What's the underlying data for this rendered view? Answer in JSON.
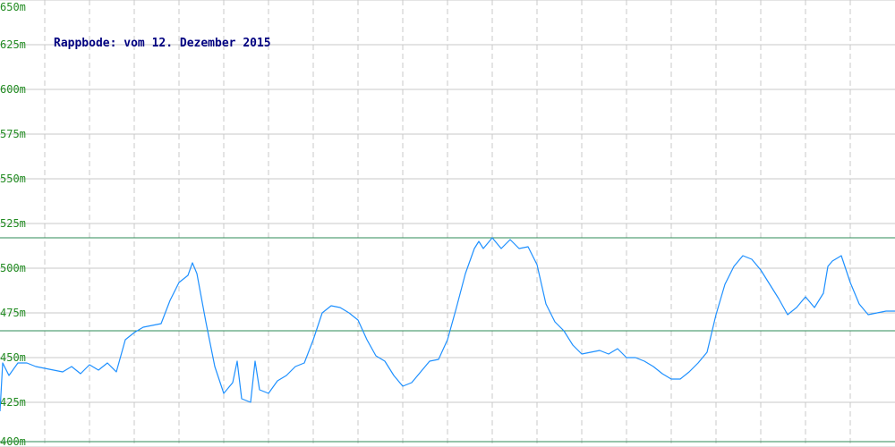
{
  "chart_data": {
    "type": "line",
    "title": "Rappbode: vom 12. Dezember 2015",
    "xlabel": "",
    "ylabel": "",
    "ylim": [
      400,
      650
    ],
    "yticks": [
      {
        "value": 650,
        "label": "650m"
      },
      {
        "value": 625,
        "label": "625m"
      },
      {
        "value": 600,
        "label": "600m"
      },
      {
        "value": 575,
        "label": "575m"
      },
      {
        "value": 550,
        "label": "550m"
      },
      {
        "value": 525,
        "label": "525m"
      },
      {
        "value": 500,
        "label": "500m"
      },
      {
        "value": 475,
        "label": "475m"
      },
      {
        "value": 450,
        "label": "450m"
      },
      {
        "value": 425,
        "label": "425m"
      },
      {
        "value": 400,
        "label": "400m"
      }
    ],
    "grid": true,
    "reference_lines": [
      517,
      465,
      403
    ],
    "colors": {
      "line": "#1e90ff",
      "reference": "#2e8b57",
      "ticks": "#228b22",
      "title": "#000080"
    },
    "series": [
      {
        "points": [
          [
            0,
            420
          ],
          [
            0.3,
            447
          ],
          [
            1,
            440
          ],
          [
            2,
            447
          ],
          [
            3,
            447
          ],
          [
            4,
            445
          ],
          [
            5,
            444
          ],
          [
            6,
            443
          ],
          [
            7,
            442
          ],
          [
            8,
            445
          ],
          [
            9,
            441
          ],
          [
            10,
            446
          ],
          [
            11,
            443
          ],
          [
            12,
            447
          ],
          [
            13,
            442
          ],
          [
            14,
            460
          ],
          [
            15,
            464
          ],
          [
            16,
            467
          ],
          [
            17,
            468
          ],
          [
            18,
            469
          ],
          [
            19,
            482
          ],
          [
            20,
            492
          ],
          [
            21,
            496
          ],
          [
            21.5,
            503
          ],
          [
            22,
            497
          ],
          [
            23,
            470
          ],
          [
            24,
            445
          ],
          [
            25,
            430
          ],
          [
            26,
            436
          ],
          [
            26.5,
            448
          ],
          [
            27,
            427
          ],
          [
            28,
            425
          ],
          [
            28.5,
            448
          ],
          [
            29,
            432
          ],
          [
            30,
            430
          ],
          [
            31,
            437
          ],
          [
            32,
            440
          ],
          [
            33,
            445
          ],
          [
            34,
            447
          ],
          [
            35,
            460
          ],
          [
            36,
            475
          ],
          [
            37,
            479
          ],
          [
            38,
            478
          ],
          [
            39,
            475
          ],
          [
            40,
            471
          ],
          [
            41,
            460
          ],
          [
            42,
            451
          ],
          [
            43,
            448
          ],
          [
            44,
            440
          ],
          [
            45,
            434
          ],
          [
            46,
            436
          ],
          [
            47,
            442
          ],
          [
            48,
            448
          ],
          [
            49,
            449
          ],
          [
            50,
            460
          ],
          [
            51,
            478
          ],
          [
            52,
            497
          ],
          [
            53,
            511
          ],
          [
            53.5,
            515
          ],
          [
            54,
            511
          ],
          [
            55,
            517
          ],
          [
            56,
            511
          ],
          [
            57,
            516
          ],
          [
            58,
            511
          ],
          [
            59,
            512
          ],
          [
            60,
            502
          ],
          [
            61,
            480
          ],
          [
            62,
            470
          ],
          [
            63,
            465
          ],
          [
            64,
            457
          ],
          [
            65,
            452
          ],
          [
            66,
            453
          ],
          [
            67,
            454
          ],
          [
            68,
            452
          ],
          [
            69,
            455
          ],
          [
            70,
            450
          ],
          [
            71,
            450
          ],
          [
            72,
            448
          ],
          [
            73,
            445
          ],
          [
            74,
            441
          ],
          [
            75,
            438
          ],
          [
            76,
            438
          ],
          [
            77,
            442
          ],
          [
            78,
            447
          ],
          [
            79,
            453
          ],
          [
            80,
            474
          ],
          [
            81,
            491
          ],
          [
            82,
            501
          ],
          [
            83,
            507
          ],
          [
            84,
            505
          ],
          [
            85,
            499
          ],
          [
            86,
            491
          ],
          [
            87,
            483
          ],
          [
            88,
            474
          ],
          [
            89,
            478
          ],
          [
            90,
            484
          ],
          [
            91,
            478
          ],
          [
            92,
            486
          ],
          [
            92.5,
            501
          ],
          [
            93,
            504
          ],
          [
            94,
            507
          ],
          [
            95,
            492
          ],
          [
            96,
            480
          ],
          [
            97,
            474
          ],
          [
            98,
            475
          ],
          [
            99,
            476
          ],
          [
            100,
            476
          ]
        ]
      }
    ]
  }
}
